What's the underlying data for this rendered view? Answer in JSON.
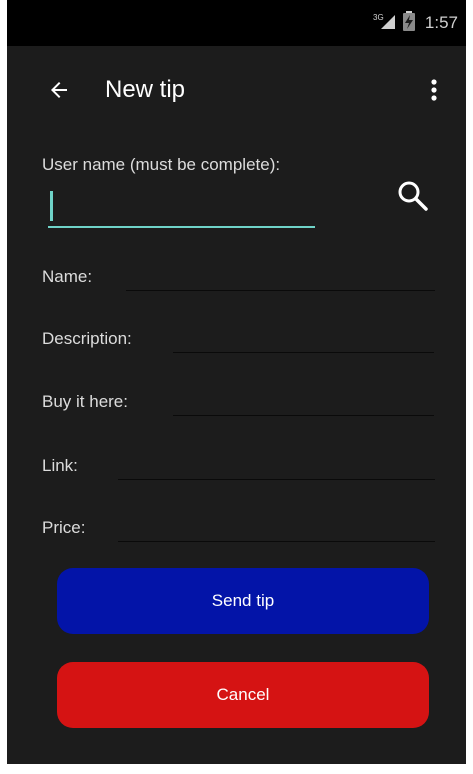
{
  "status_bar": {
    "network": "3G",
    "time": "1:57"
  },
  "app_bar": {
    "title": "New tip",
    "back_icon": "arrow-left-icon",
    "menu_icon": "more-vert-icon"
  },
  "form": {
    "username_label": "User name (must be complete):",
    "username_value": "",
    "search_icon": "search-icon",
    "fields": [
      {
        "label": "Name:",
        "value": ""
      },
      {
        "label": "Description:",
        "value": ""
      },
      {
        "label": "Buy it here:",
        "value": ""
      },
      {
        "label": "Link:",
        "value": ""
      },
      {
        "label": "Price:",
        "value": ""
      }
    ]
  },
  "buttons": {
    "send_label": "Send tip",
    "cancel_label": "Cancel"
  },
  "colors": {
    "background": "#1c1c1c",
    "status_bar": "#000000",
    "accent": "#6fd3c8",
    "send_button": "#0314a8",
    "cancel_button": "#d51313",
    "text": "#dcdcdc"
  }
}
